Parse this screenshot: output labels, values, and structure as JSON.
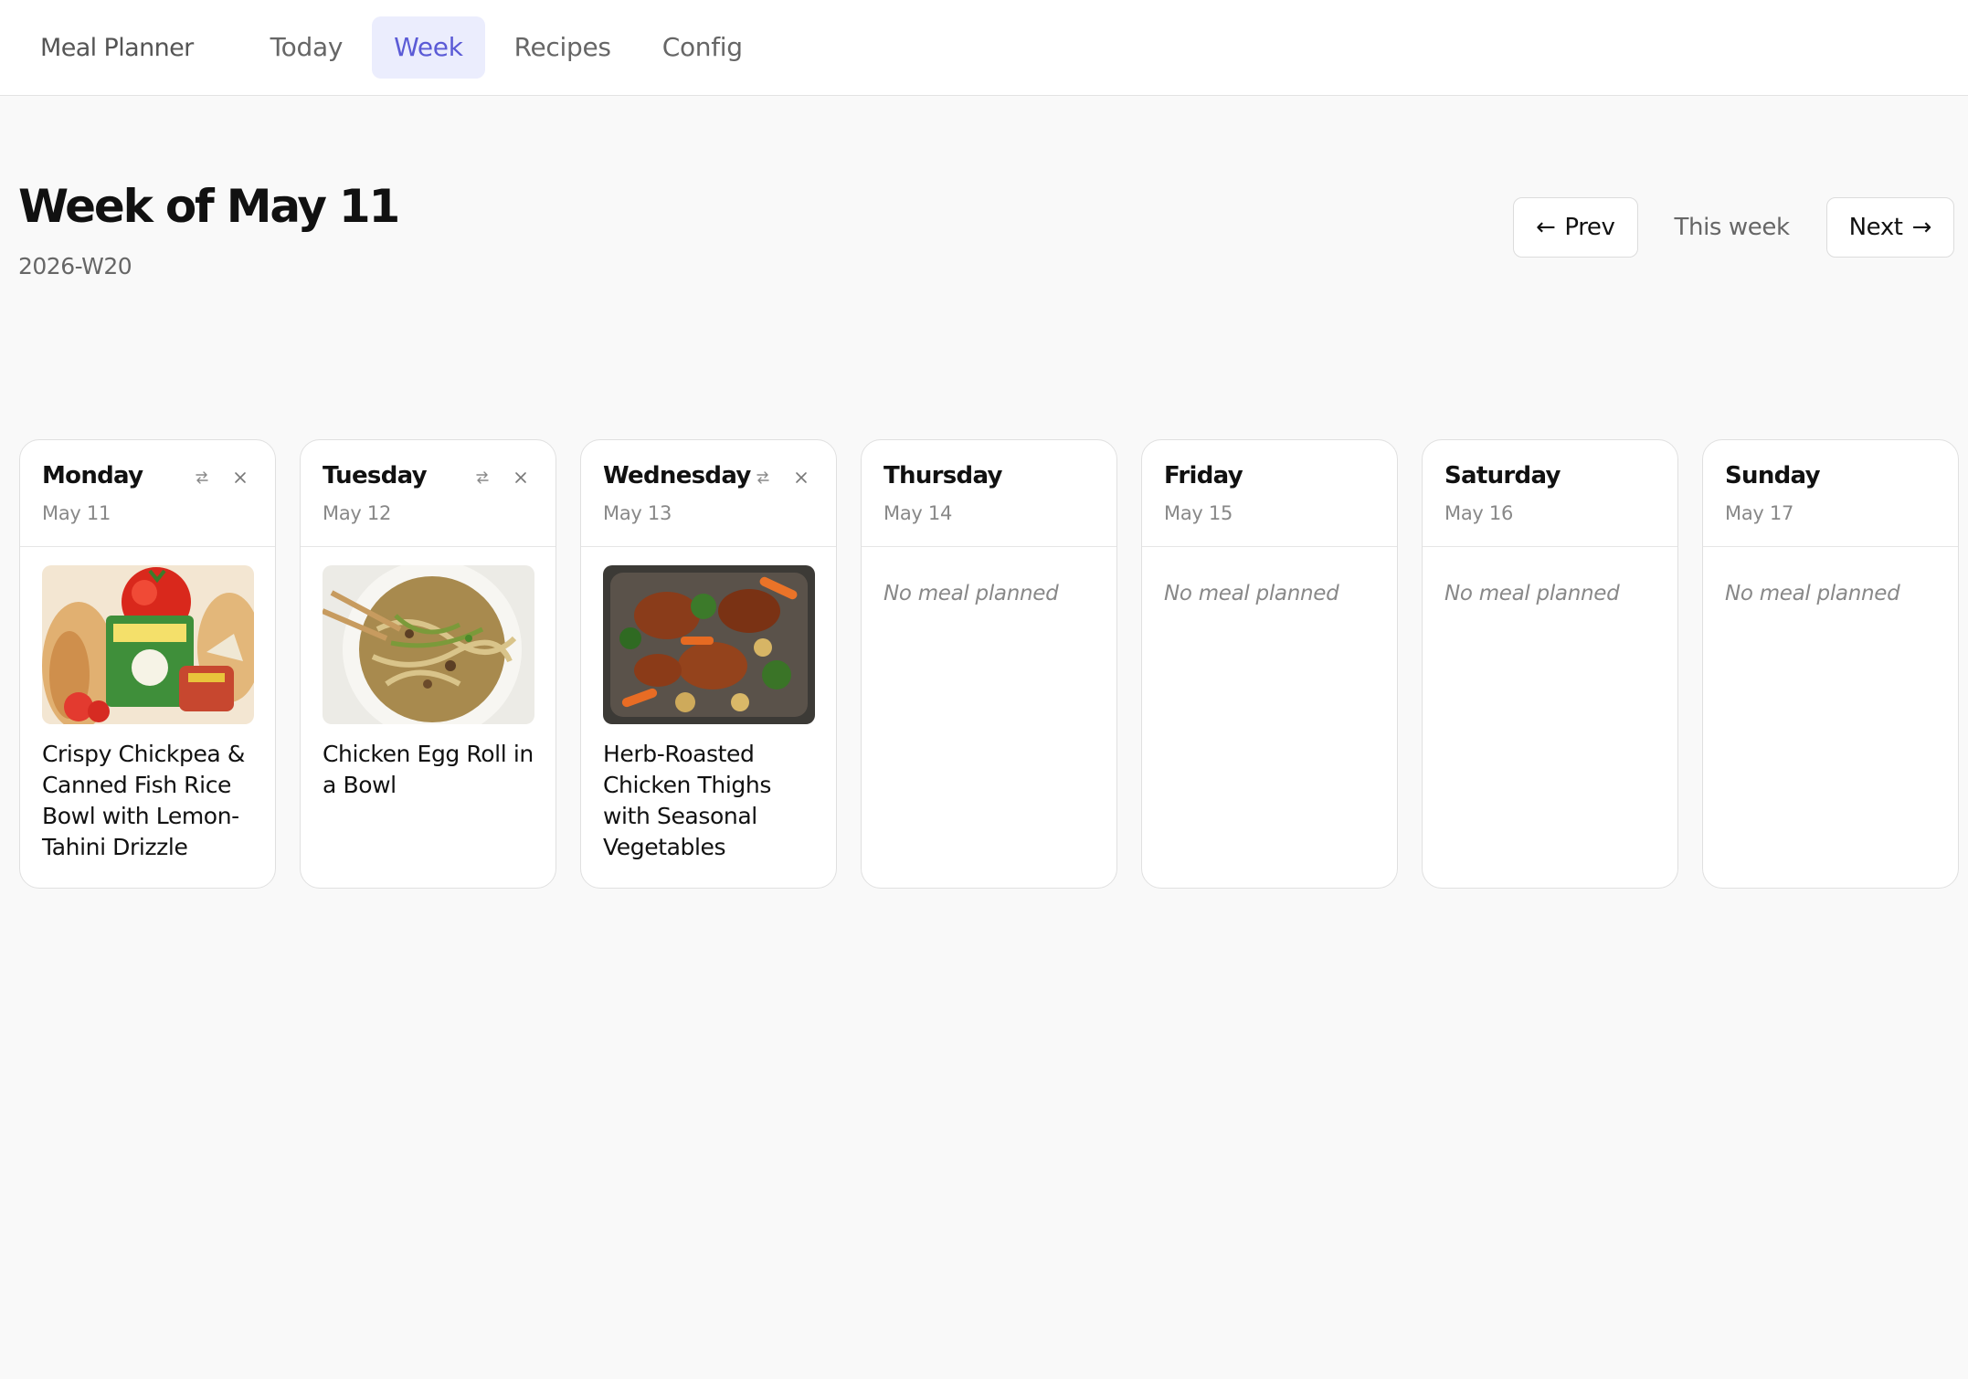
{
  "app": {
    "title": "Meal Planner"
  },
  "nav": {
    "tabs": [
      {
        "label": "Today"
      },
      {
        "label": "Week"
      },
      {
        "label": "Recipes"
      },
      {
        "label": "Config"
      }
    ],
    "active": "Week"
  },
  "header": {
    "title": "Week of May 11",
    "subtitle": "2026-W20",
    "prev_label": "Prev",
    "this_week_label": "This week",
    "next_label": "Next"
  },
  "days": [
    {
      "name": "Monday",
      "date": "May 11",
      "meal": "Crispy Chickpea & Canned Fish Rice Bowl with Lemon-Tahini Drizzle",
      "image": "canned-fish-photo"
    },
    {
      "name": "Tuesday",
      "date": "May 12",
      "meal": "Chicken Egg Roll in a Bowl",
      "image": "egg-roll-bowl-photo"
    },
    {
      "name": "Wednesday",
      "date": "May 13",
      "meal": "Herb-Roasted Chicken Thighs with Seasonal Vegetables",
      "image": "roasted-chicken-photo"
    },
    {
      "name": "Thursday",
      "date": "May 14",
      "meal": null,
      "empty_label": "No meal planned"
    },
    {
      "name": "Friday",
      "date": "May 15",
      "meal": null,
      "empty_label": "No meal planned"
    },
    {
      "name": "Saturday",
      "date": "May 16",
      "meal": null,
      "empty_label": "No meal planned"
    },
    {
      "name": "Sunday",
      "date": "May 17",
      "meal": null,
      "empty_label": "No meal planned"
    }
  ],
  "icons": {
    "swap": "swap-icon",
    "remove": "close-icon",
    "prev": "arrow-left-icon",
    "next": "arrow-right-icon"
  },
  "colors": {
    "accent": "#5b5bd6",
    "accent_bg": "#ebedfd",
    "page_bg": "#f9f9f9"
  }
}
